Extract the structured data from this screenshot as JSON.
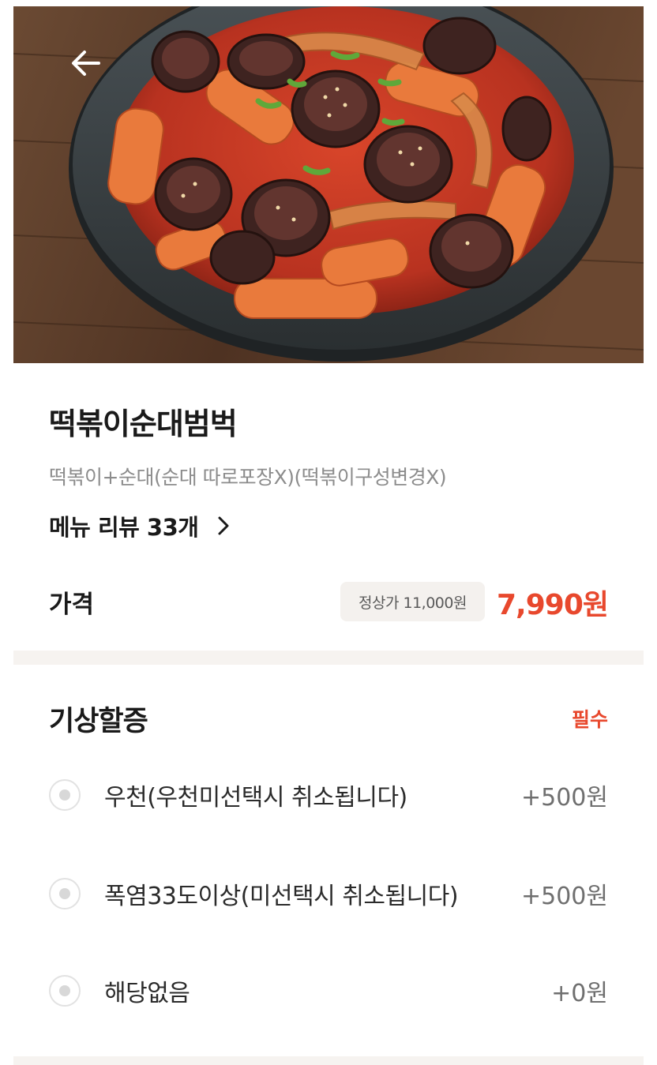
{
  "product": {
    "name": "떡볶이순대범벅",
    "description": "떡볶이+순대(순대 따로포장X)(떡볶이구성변경X)",
    "review_link": "메뉴 리뷰 33개"
  },
  "price": {
    "label": "가격",
    "original": "정상가 11,000원",
    "sale": "7,990원"
  },
  "option_group": {
    "title": "기상할증",
    "required_label": "필수",
    "options": [
      {
        "label": "우천(우천미선택시 취소됩니다)",
        "price": "+500원"
      },
      {
        "label": "폭염33도이상(미선택시 취소됩니다)",
        "price": "+500원"
      },
      {
        "label": "해당없음",
        "price": "+0원"
      }
    ]
  },
  "colors": {
    "accent": "#e8482d",
    "muted_text": "#8c8c8c",
    "divider": "#f6f3f0"
  },
  "icons": {
    "back": "arrow-left-icon",
    "review_chevron": "chevron-right-icon"
  }
}
